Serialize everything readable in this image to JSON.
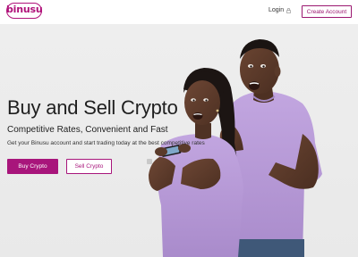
{
  "header": {
    "logo_text": "binusu",
    "login_label": "Login",
    "create_account_label": "Create Account"
  },
  "hero": {
    "headline": "Buy and Sell Crypto",
    "subheadline": "Competitive Rates, Convenient and Fast",
    "description": "Get your Binusu account and start trading today at the best competitive rates",
    "buy_button": "Buy Crypto",
    "sell_button": "Sell Crypto"
  },
  "colors": {
    "brand": "#a8157b",
    "shirt": "#b79ad8"
  },
  "icons": {
    "login": "lock-icon"
  }
}
